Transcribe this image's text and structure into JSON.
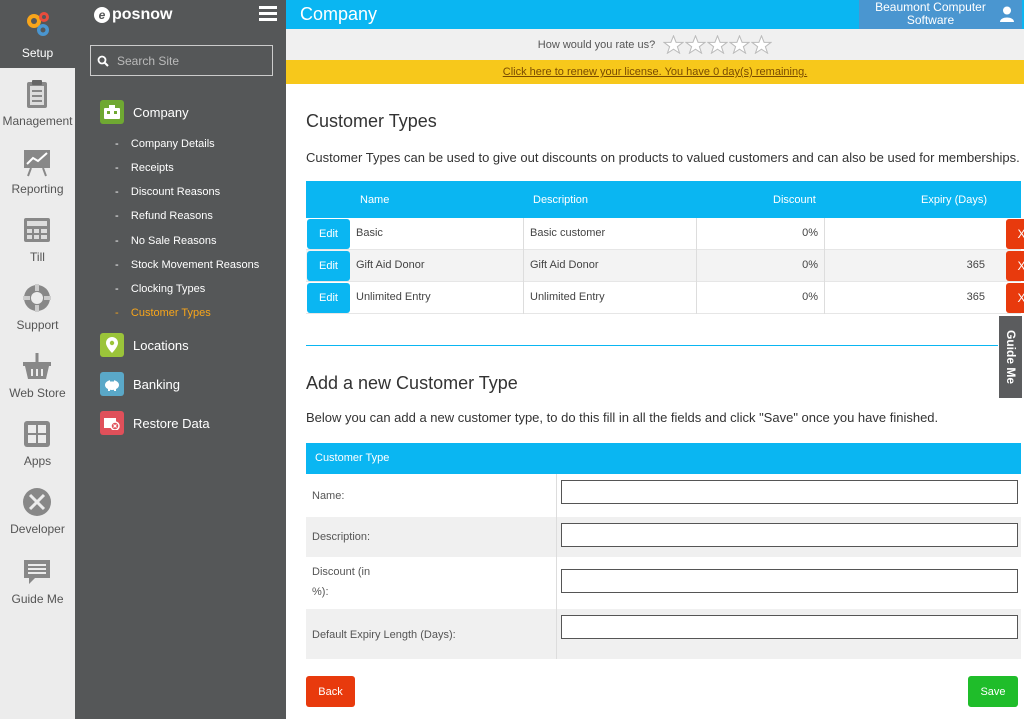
{
  "rail": {
    "items": [
      {
        "label": "Setup",
        "icon": "gears-icon"
      },
      {
        "label": "Management",
        "icon": "clipboard-icon"
      },
      {
        "label": "Reporting",
        "icon": "chart-easel-icon"
      },
      {
        "label": "Till",
        "icon": "till-icon"
      },
      {
        "label": "Support",
        "icon": "lifebuoy-icon"
      },
      {
        "label": "Web Store",
        "icon": "basket-icon"
      },
      {
        "label": "Apps",
        "icon": "apps-icon"
      },
      {
        "label": "Developer",
        "icon": "tools-icon"
      },
      {
        "label": "Guide Me",
        "icon": "chat-list-icon"
      }
    ]
  },
  "sidebar": {
    "logo": "posnow",
    "search_placeholder": "Search Site",
    "sections": [
      {
        "label": "Company",
        "icon": "company-icon",
        "color": "#6fa832"
      },
      {
        "label": "Locations",
        "icon": "location-pin-icon",
        "color": "#9bc43a"
      },
      {
        "label": "Banking",
        "icon": "piggy-bank-icon",
        "color": "#5aa8c8"
      },
      {
        "label": "Restore Data",
        "icon": "restore-icon",
        "color": "#e0505a"
      }
    ],
    "company_links": [
      "Company Details",
      "Receipts",
      "Discount Reasons",
      "Refund Reasons",
      "No Sale Reasons",
      "Stock Movement Reasons",
      "Clocking Types",
      "Customer Types"
    ],
    "active_link": "Customer Types"
  },
  "header": {
    "title": "Company",
    "account_line1": "Beaumont Computer",
    "account_line2": "Software"
  },
  "rating": {
    "prompt": "How would you rate us?",
    "stars": 5
  },
  "renew_text": "Click here to renew your license. You have 0 day(s) remaining.",
  "main": {
    "title": "Customer Types",
    "description": "Customer Types can be used to give out discounts on products to valued customers and can also be used for memberships.",
    "columns": [
      "Name",
      "Description",
      "Discount",
      "Expiry (Days)"
    ],
    "edit_label": "Edit",
    "delete_label": "X",
    "rows": [
      {
        "name": "Basic",
        "description": "Basic customer",
        "discount": "0%",
        "expiry": ""
      },
      {
        "name": "Gift Aid Donor",
        "description": "Gift Aid Donor",
        "discount": "0%",
        "expiry": "365"
      },
      {
        "name": "Unlimited Entry",
        "description": "Unlimited Entry",
        "discount": "0%",
        "expiry": "365"
      }
    ]
  },
  "guide_me": "Guide Me",
  "add": {
    "title": "Add a new Customer Type",
    "description": "Below you can add a new customer type, to do this fill in all the fields and click \"Save\" once you have finished.",
    "form_header": "Customer Type",
    "fields": {
      "name": "Name:",
      "description": "Description:",
      "discount_line1": "Discount (in",
      "discount_line2": "%):",
      "expiry": "Default Expiry Length (Days):"
    },
    "back_label": "Back",
    "save_label": "Save"
  },
  "colors": {
    "accent": "#0ab6f2",
    "danger": "#e83a0d",
    "success": "#1fbd2a",
    "sidebar": "#555758",
    "warning": "#f7c81b"
  }
}
